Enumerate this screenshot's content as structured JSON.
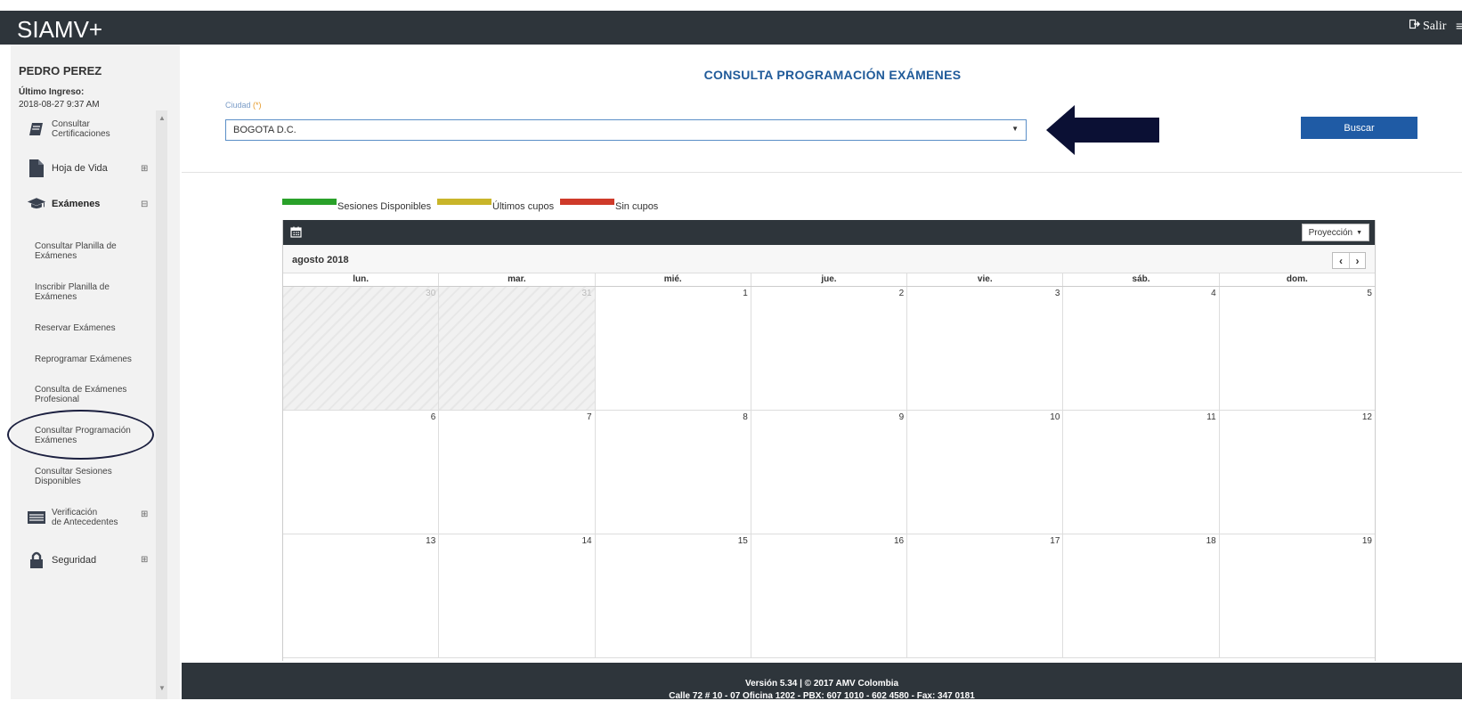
{
  "app": {
    "brand": "SIAMV+",
    "logout_label": "Salir",
    "menu_glyph": "≡"
  },
  "user": {
    "name": "PEDRO PEREZ",
    "last_login_label": "Último Ingreso:",
    "last_login_value": "2018-08-27 9:37 AM"
  },
  "sidebar": {
    "items": [
      {
        "label": "Consultar\nCertificaciones",
        "icon": "certificate-icon"
      },
      {
        "label": "Hoja de Vida",
        "icon": "document-icon",
        "toggle": "⊞"
      },
      {
        "label": "Exámenes",
        "icon": "graduation-cap-icon",
        "toggle": "⊟"
      },
      {
        "label": "Verificación\nde Antecedentes",
        "icon": "id-card-icon",
        "toggle": "⊞"
      },
      {
        "label": "Seguridad",
        "icon": "lock-icon",
        "toggle": "⊞"
      }
    ],
    "exam_subitems": [
      "Consultar Planilla de Exámenes",
      "Inscribir Planilla de Exámenes",
      "Reservar Exámenes",
      "Reprogramar Exámenes",
      "Consulta de Exámenes Profesional",
      "Consultar Programación Exámenes",
      "Consultar Sesiones Disponibles"
    ]
  },
  "main": {
    "title": "CONSULTA PROGRAMACIÓN EXÁMENES",
    "city_label": "Ciudad",
    "city_required": "(*)",
    "city_value": "BOGOTA D.C.",
    "search_button": "Buscar"
  },
  "legend": [
    {
      "label": "Sesiones Disponibles",
      "color": "#2aa12a"
    },
    {
      "label": "Últimos cupos",
      "color": "#c9b52a"
    },
    {
      "label": "Sin cupos",
      "color": "#cf3a2a"
    }
  ],
  "calendar": {
    "view_button": "Proyección",
    "month": "agosto 2018",
    "days_of_week": [
      "lun.",
      "mar.",
      "mié.",
      "jue.",
      "vie.",
      "sáb.",
      "dom."
    ],
    "weeks": [
      [
        "30",
        "31",
        "1",
        "2",
        "3",
        "4",
        "5"
      ],
      [
        "6",
        "7",
        "8",
        "9",
        "10",
        "11",
        "12"
      ],
      [
        "13",
        "14",
        "15",
        "16",
        "17",
        "18",
        "19"
      ]
    ],
    "other_month_days": [
      "30",
      "31"
    ]
  },
  "footer": {
    "line1": "Versión 5.34 | © 2017 AMV Colombia",
    "line2": "Calle 72 # 10 - 07 Oficina 1202 - PBX: 607 1010 - 602 4580 - Fax: 347 0181"
  },
  "colors": {
    "topbar": "#2e353b",
    "title": "#1f5a99",
    "button": "#1f5ba5",
    "arrow": "#0b1034"
  }
}
